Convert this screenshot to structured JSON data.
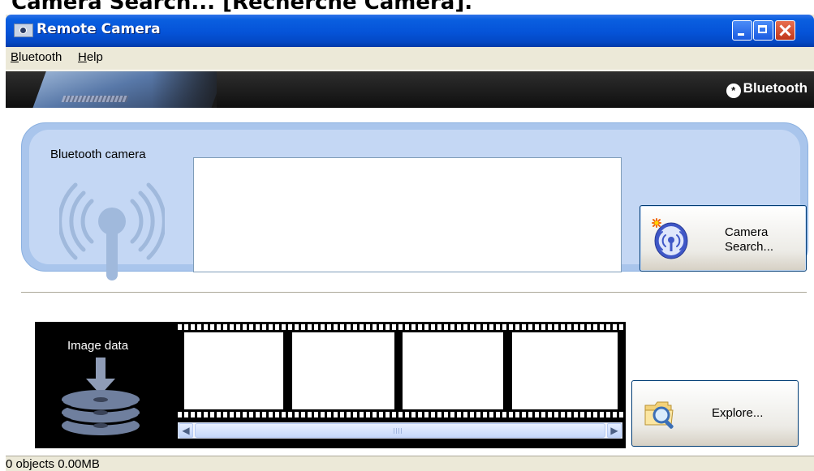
{
  "caption": "Camera Search... [Recherche Caméra].",
  "window": {
    "title": "Remote Camera"
  },
  "menu": {
    "bluetooth_prefix": "B",
    "bluetooth_rest": "luetooth",
    "help_prefix": "H",
    "help_rest": "elp"
  },
  "banner": {
    "brand": "Bluetooth",
    "brand_mark": "*"
  },
  "camera": {
    "label": "Bluetooth camera",
    "search_line1": "Camera",
    "search_line2": "Search..."
  },
  "images": {
    "label": "Image data",
    "explore": "Explore..."
  },
  "status": {
    "text": "0 objects 0.00MB"
  },
  "colors": {
    "titlebar": "#0553d8",
    "panel": "#c4d7f4",
    "panel_border": "#a9c5ec",
    "film": "#000000",
    "window_bg": "#ece9d8"
  }
}
